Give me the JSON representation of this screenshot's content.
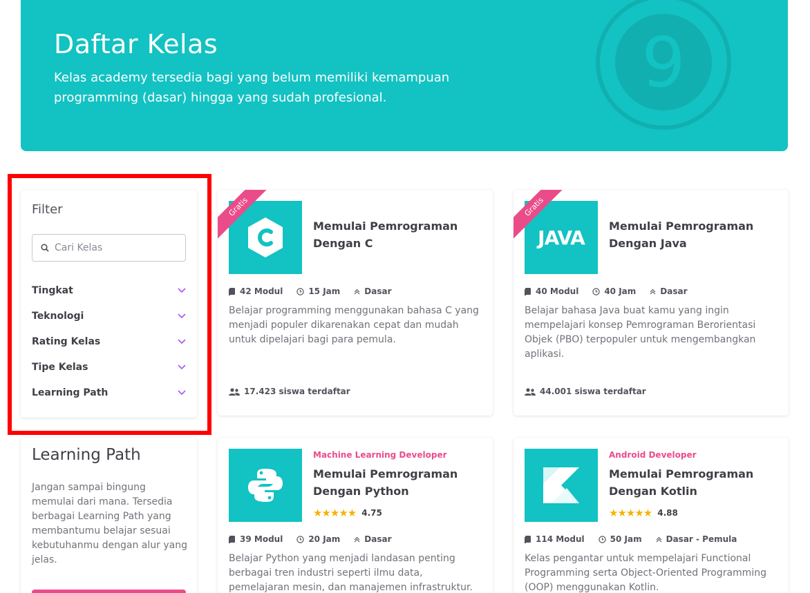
{
  "hero": {
    "title": "Daftar Kelas",
    "subtitle": "Kelas academy tersedia bagi yang belum memiliki kemampuan programming (dasar) hingga yang sudah profesional."
  },
  "filter": {
    "title": "Filter",
    "search_placeholder": "Cari Kelas",
    "items": [
      {
        "label": "Tingkat"
      },
      {
        "label": "Teknologi"
      },
      {
        "label": "Rating Kelas"
      },
      {
        "label": "Tipe Kelas"
      },
      {
        "label": "Learning Path"
      }
    ]
  },
  "learning_path": {
    "title": "Learning Path",
    "text": "Jangan sampai bingung memulai dari mana. Tersedia berbagai Learning Path yang membantumu belajar sesuai kebutuhanmu dengan alur yang jelas."
  },
  "courses": [
    {
      "ribbon": "Gratis",
      "title": "Memulai Pemrograman Dengan C",
      "modules": "42 Modul",
      "hours": "15 Jam",
      "level": "Dasar",
      "description": "Belajar programming menggunakan bahasa C yang menjadi populer dikarenakan cepat dan mudah untuk dipelajari bagi para pemula.",
      "students": "17.423 siswa terdaftar"
    },
    {
      "ribbon": "Gratis",
      "thumb_text": "JAVA",
      "title": "Memulai Pemrograman Dengan Java",
      "modules": "40 Modul",
      "hours": "40 Jam",
      "level": "Dasar",
      "description": "Belajar bahasa Java buat kamu yang ingin mempelajari konsep Pemrograman Berorientasi Objek (PBO) terpopuler untuk mengembangkan aplikasi.",
      "students": "44.001 siswa terdaftar"
    },
    {
      "tag": "Machine Learning Developer",
      "title": "Memulai Pemrograman Dengan Python",
      "rating": "4.75",
      "modules": "39 Modul",
      "hours": "20 Jam",
      "level": "Dasar",
      "description": "Belajar Python yang menjadi landasan penting berbagai tren industri seperti ilmu data, pemelajaran mesin, dan manajemen infrastruktur."
    },
    {
      "tag": "Android Developer",
      "title": "Memulai Pemrograman Dengan Kotlin",
      "rating": "4.88",
      "modules": "114 Modul",
      "hours": "50 Jam",
      "level": "Dasar - Pemula",
      "description": "Kelas pengantar untuk mempelajari Functional Programming serta Object-Oriented Programming (OOP) menggunakan Kotlin."
    }
  ],
  "colors": {
    "accent": "#13c2c2",
    "pink": "#ea4c89",
    "chevron": "#a855f7",
    "star": "#f5b301"
  }
}
